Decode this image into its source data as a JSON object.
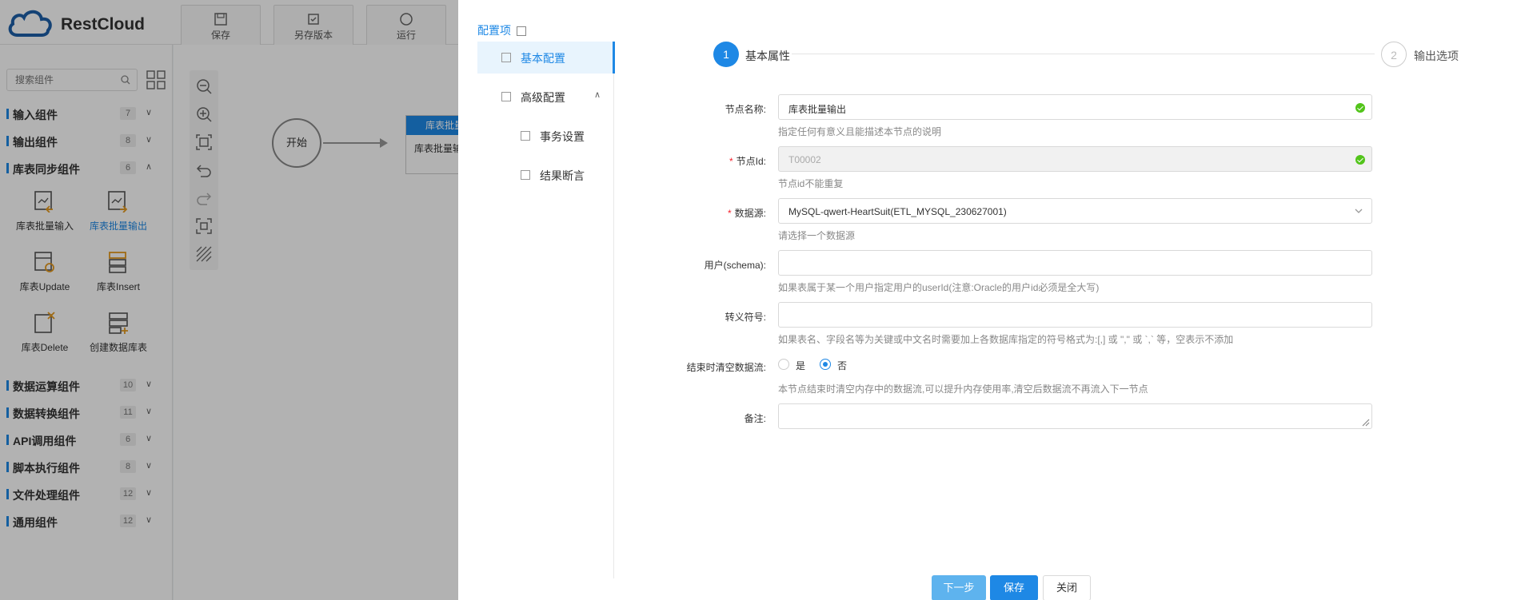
{
  "app": {
    "logo_text": "RestCloud"
  },
  "toolbar": {
    "save_label": "保存",
    "saveas_label": "另存版本",
    "run_label": "运行"
  },
  "sidebar": {
    "search_placeholder": "搜索组件",
    "categories": [
      {
        "name": "输入组件",
        "count": "7"
      },
      {
        "name": "输出组件",
        "count": "8"
      },
      {
        "name": "库表同步组件",
        "count": "6"
      },
      {
        "name": "数据运算组件",
        "count": "10"
      },
      {
        "name": "数据转换组件",
        "count": "11"
      },
      {
        "name": "API调用组件",
        "count": "6"
      },
      {
        "name": "脚本执行组件",
        "count": "8"
      },
      {
        "name": "文件处理组件",
        "count": "12"
      },
      {
        "name": "通用组件",
        "count": "12"
      }
    ],
    "components": [
      {
        "label": "库表批量输入"
      },
      {
        "label": "库表批量输出"
      },
      {
        "label": "库表Update"
      },
      {
        "label": "库表Insert"
      },
      {
        "label": "库表Delete"
      },
      {
        "label": "创建数据库表"
      }
    ]
  },
  "canvas": {
    "start_label": "开始",
    "task_header": "库表批量",
    "task_body": "库表批量输"
  },
  "drawer": {
    "config_title": "配置项",
    "nav": [
      {
        "label": "基本配置"
      },
      {
        "label": "高级配置"
      },
      {
        "label": "事务设置"
      },
      {
        "label": "结果断言"
      }
    ],
    "steps": [
      {
        "num": "1",
        "label": "基本属性"
      },
      {
        "num": "2",
        "label": "输出选项"
      }
    ],
    "form": {
      "node_name": {
        "label": "节点名称:",
        "value": "库表批量输出",
        "help": "指定任何有意义且能描述本节点的说明"
      },
      "node_id": {
        "label": "节点Id:",
        "value": "T00002",
        "help": "节点id不能重复"
      },
      "datasource": {
        "label": "数据源:",
        "value": "MySQL-qwert-HeartSuit(ETL_MYSQL_230627001)",
        "help": "请选择一个数据源"
      },
      "schema": {
        "label": "用户(schema):",
        "value": "",
        "help": "如果表属于某一个用户指定用户的userId(注意:Oracle的用户id必须是全大写)"
      },
      "escape": {
        "label": "转义符号:",
        "value": "",
        "help": "如果表名、字段名等为关键或中文名时需要加上各数据库指定的符号格式为:[,] 或 \",\" 或 `,` 等，空表示不添加"
      },
      "clear_stream": {
        "label": "结束时清空数据流:",
        "opt_yes": "是",
        "opt_no": "否",
        "selected": "否",
        "help": "本节点结束时清空内存中的数据流,可以提升内存使用率,清空后数据流不再流入下一节点"
      },
      "remark": {
        "label": "备注:",
        "value": ""
      }
    },
    "buttons": {
      "next": "下一步",
      "save": "保存",
      "close": "关闭"
    }
  }
}
